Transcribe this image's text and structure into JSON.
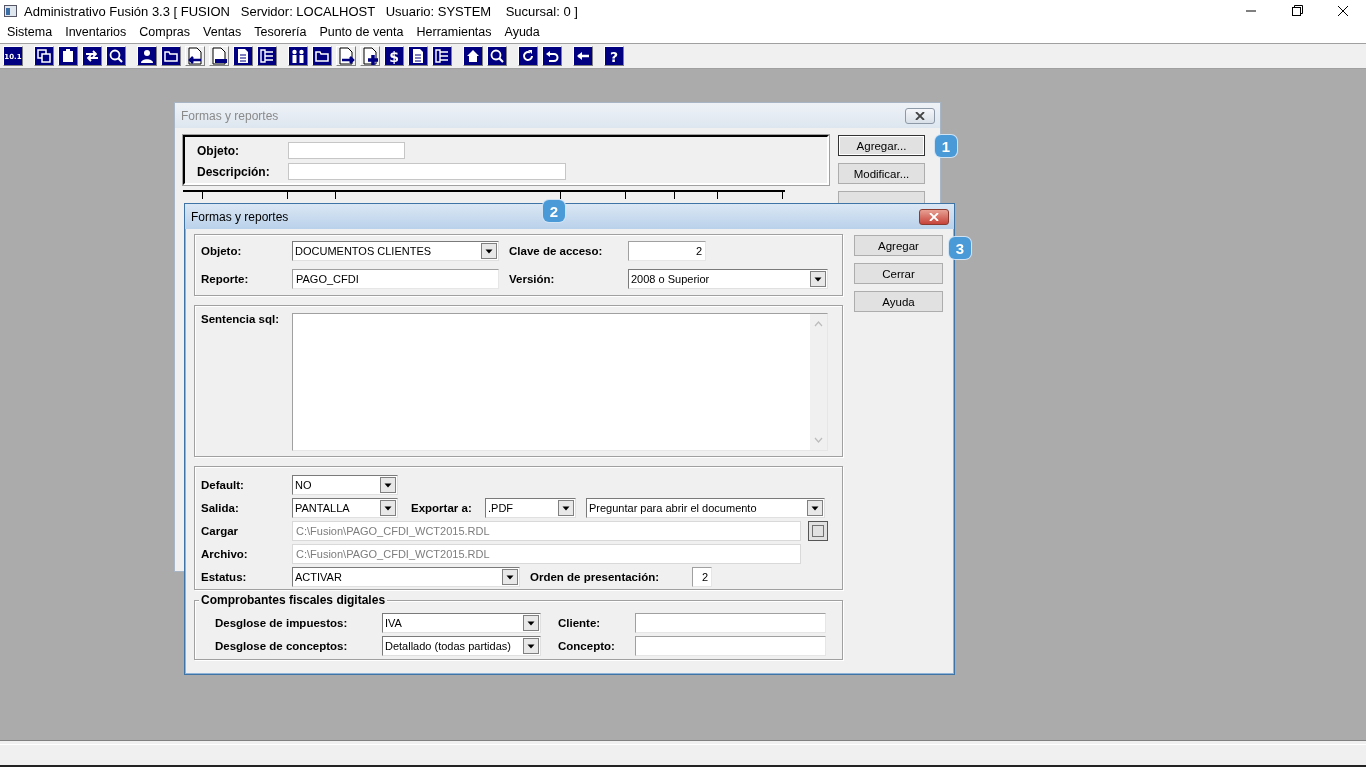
{
  "app_window": {
    "title": "Administrativo Fusión 3.3 [ FUSION   Servidor: LOCALHOST   Usuario: SYSTEM    Sucursal: 0 ]"
  },
  "menu": [
    "Sistema",
    "Inventarios",
    "Compras",
    "Ventas",
    "Tesorería",
    "Punto de venta",
    "Herramientas",
    "Ayuda"
  ],
  "toolbar": [
    [
      {
        "kind": "number",
        "glyph": "10.1"
      }
    ],
    [
      {
        "kind": "copy"
      },
      {
        "kind": "clipboard"
      },
      {
        "kind": "swap"
      },
      {
        "kind": "search"
      }
    ],
    [
      {
        "kind": "person"
      },
      {
        "kind": "folder"
      },
      {
        "kind": "doc_left"
      },
      {
        "kind": "doc_minus"
      },
      {
        "kind": "doc"
      },
      {
        "kind": "list"
      }
    ],
    [
      {
        "kind": "people"
      },
      {
        "kind": "folder"
      },
      {
        "kind": "doc_right"
      },
      {
        "kind": "doc_plus"
      },
      {
        "kind": "dollar",
        "glyph": "$"
      },
      {
        "kind": "doc"
      },
      {
        "kind": "list"
      }
    ],
    [
      {
        "kind": "home"
      },
      {
        "kind": "search"
      }
    ],
    [
      {
        "kind": "refresh"
      },
      {
        "kind": "undo"
      }
    ],
    [
      {
        "kind": "back"
      }
    ],
    [
      {
        "kind": "help",
        "glyph": "?"
      }
    ]
  ],
  "back_dialog": {
    "title": "Formas y reportes",
    "active": false,
    "objeto_label": "Objeto:",
    "descripcion_label": "Descripción:",
    "buttons": [
      "Agregar...",
      "Modificar..."
    ]
  },
  "front_dialog": {
    "title": "Formas y reportes",
    "active": true,
    "objeto": {
      "label": "Objeto:",
      "value": "DOCUMENTOS CLIENTES"
    },
    "clave": {
      "label": "Clave de acceso:",
      "value": "2"
    },
    "reporte": {
      "label": "Reporte:",
      "value": "PAGO_CFDI"
    },
    "version": {
      "label": "Versión:",
      "value": "2008 o Superior"
    },
    "sentencia": {
      "label": "Sentencia sql:"
    },
    "default": {
      "label": "Default:",
      "value": "NO"
    },
    "salida": {
      "label": "Salida:",
      "value": "PANTALLA"
    },
    "exportar": {
      "label": "Exportar a:",
      "value": ".PDF"
    },
    "abrir": {
      "value": "Preguntar para abrir el documento"
    },
    "cargar": {
      "label": "Cargar",
      "value": "C:\\Fusion\\PAGO_CFDI_WCT2015.RDL",
      "disabled": true
    },
    "archivo": {
      "label": "Archivo:",
      "value": "C:\\Fusion\\PAGO_CFDI_WCT2015.RDL",
      "disabled": true
    },
    "estatus": {
      "label": "Estatus:",
      "value": "ACTIVAR"
    },
    "orden": {
      "label": "Orden de presentación:",
      "value": "2"
    },
    "cfd": {
      "legend": "Comprobantes fiscales digitales",
      "impuestos": {
        "label": "Desglose de impuestos:",
        "value": "IVA"
      },
      "conceptos": {
        "label": "Desglose de conceptos:",
        "value": "Detallado (todas partidas)"
      },
      "cliente": {
        "label": "Cliente:"
      },
      "concepto": {
        "label": "Concepto:"
      }
    },
    "buttons": [
      "Agregar",
      "Cerrar",
      "Ayuda"
    ]
  },
  "badges": [
    "1",
    "2",
    "3"
  ]
}
